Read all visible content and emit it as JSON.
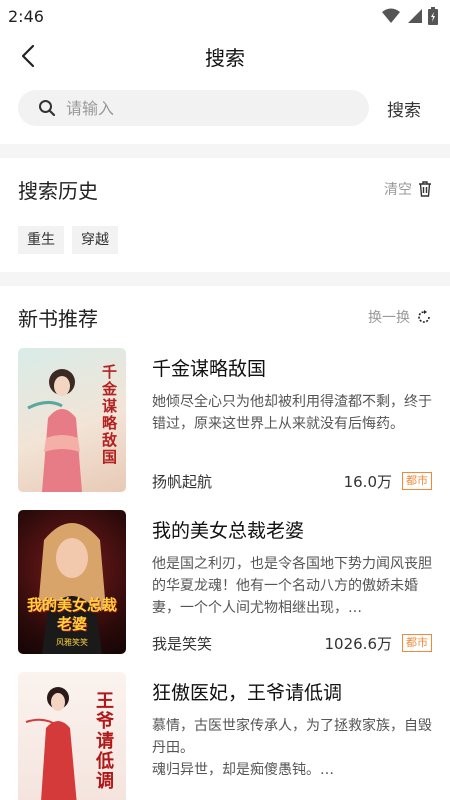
{
  "status_bar": {
    "time": "2:46"
  },
  "nav": {
    "title": "搜索"
  },
  "search": {
    "placeholder": "请输入",
    "button_label": "搜索"
  },
  "history": {
    "title": "搜索历史",
    "clear_label": "清空",
    "tags": [
      "重生",
      "穿越"
    ]
  },
  "recommend": {
    "title": "新书推荐",
    "refresh_label": "换一换",
    "books": [
      {
        "title": "千金谋略敌国",
        "description": "她倾尽全心只为他却被利用得渣都不剩，终于错过，原来这世界上从来就没有后悔药。",
        "author": "扬帆起航",
        "count": "16.0万",
        "category": "都市",
        "cover_text": "千金谋略敌国"
      },
      {
        "title": "我的美女总裁老婆",
        "description": "他是国之利刃，也是令各国地下势力闻风丧胆的华夏龙魂！他有一个名动八方的傲娇未婚妻，一个个人间尤物相继出现，…",
        "author": "我是笑笑",
        "count": "1026.6万",
        "category": "都市",
        "cover_text": "我的美女总裁老婆",
        "cover_subtext": "风雅笑笑"
      },
      {
        "title": "狂傲医妃，王爷请低调",
        "description": "慕情，古医世家传承人，为了拯救家族，自毁丹田。\n魂归异世，却是痴傻愚钝。…",
        "author": "",
        "count": "",
        "category": "",
        "cover_text": "王爷请低调"
      }
    ]
  },
  "colors": {
    "accent": "#f08a3a",
    "muted": "#999999",
    "tag_bg": "#f2f2f2"
  }
}
